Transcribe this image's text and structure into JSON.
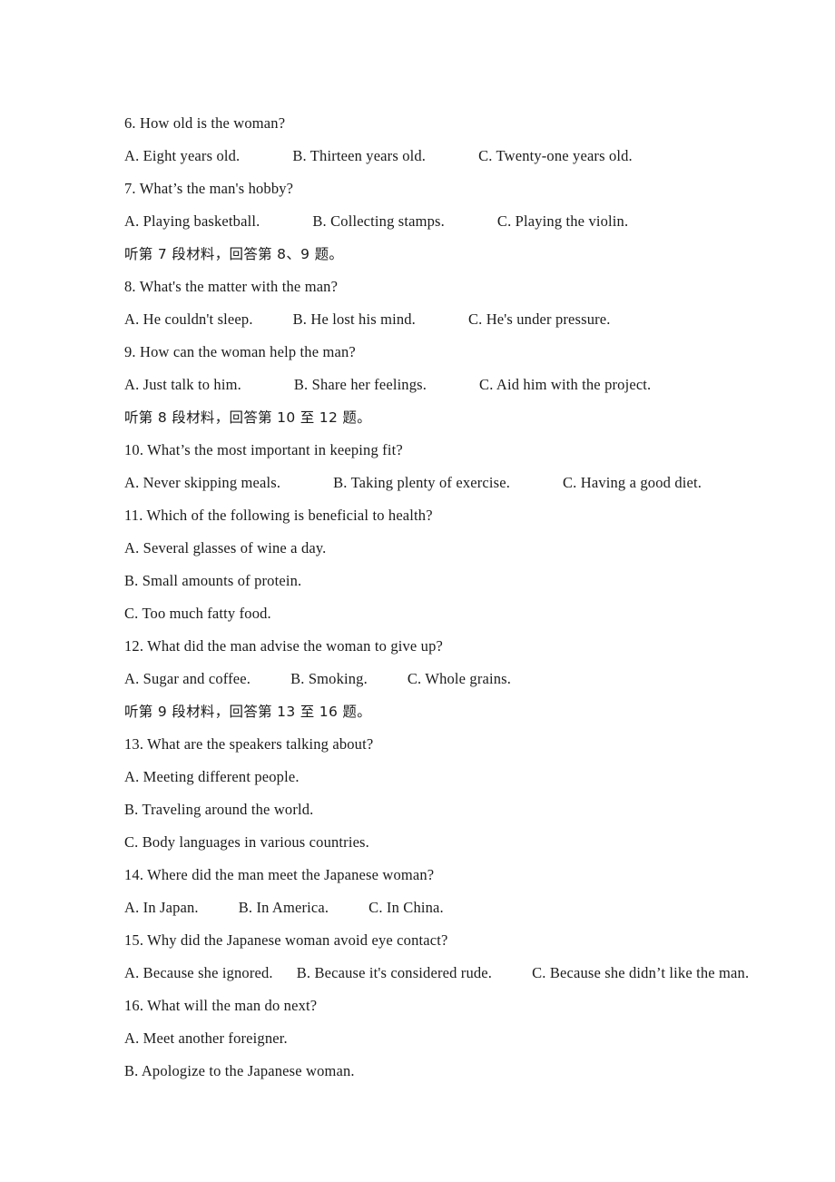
{
  "document": {
    "type": "listening-comprehension-exam-page",
    "language_primary": "English",
    "language_secondary": "Chinese",
    "background_color": "#ffffff",
    "text_color": "#1b1b1b"
  },
  "lines": [
    {
      "id": "q6-stem",
      "kind": "question",
      "text": "6. How old is the woman?"
    },
    {
      "id": "q6-options",
      "kind": "options",
      "options": [
        "A. Eight years old.",
        "B. Thirteen years old.",
        "C. Twenty-one years old."
      ],
      "gaps": [
        "lg",
        "lg"
      ]
    },
    {
      "id": "q7-stem",
      "kind": "question",
      "text": "7. What’s the man's hobby?"
    },
    {
      "id": "q7-options",
      "kind": "options",
      "options": [
        "A. Playing basketball.",
        "B. Collecting stamps.",
        "C. Playing the violin."
      ],
      "gaps": [
        "lg",
        "lg"
      ]
    },
    {
      "id": "cn-section-7",
      "kind": "chinese-instruction",
      "text": "听第 7 段材料，回答第 8、9 题。"
    },
    {
      "id": "q8-stem",
      "kind": "question",
      "text": "8. What's the matter with the man?"
    },
    {
      "id": "q8-options",
      "kind": "options",
      "options": [
        "A. He couldn't sleep.",
        "B. He lost his mind.",
        "C. He's under pressure."
      ],
      "gaps": [
        "md",
        "lg"
      ]
    },
    {
      "id": "q9-stem",
      "kind": "question",
      "text": "9. How can the woman help the man?"
    },
    {
      "id": "q9-options",
      "kind": "options",
      "options": [
        "A. Just talk to him.",
        "B. Share her feelings.",
        "C. Aid him with the project."
      ],
      "gaps": [
        "lg",
        "lg"
      ]
    },
    {
      "id": "cn-section-8",
      "kind": "chinese-instruction",
      "text": "听第 8 段材料，回答第 10 至 12 题。"
    },
    {
      "id": "q10-stem",
      "kind": "question",
      "text": "10. What’s the most important in keeping fit?"
    },
    {
      "id": "q10-options",
      "kind": "options",
      "options": [
        "A. Never skipping meals.",
        "B. Taking plenty of exercise.",
        "C. Having a good diet."
      ],
      "gaps": [
        "lg",
        "lg"
      ]
    },
    {
      "id": "q11-stem",
      "kind": "question",
      "text": "11. Which of the following is beneficial to health?"
    },
    {
      "id": "q11-option-a",
      "kind": "option-single",
      "text": "A. Several glasses of wine a day."
    },
    {
      "id": "q11-option-b",
      "kind": "option-single",
      "text": "B. Small amounts of protein."
    },
    {
      "id": "q11-option-c",
      "kind": "option-single",
      "text": "C. Too much fatty food."
    },
    {
      "id": "q12-stem",
      "kind": "question",
      "text": "12. What did the man advise the woman to give up?"
    },
    {
      "id": "q12-options",
      "kind": "options",
      "options": [
        "A. Sugar and coffee.",
        "B. Smoking.",
        "C. Whole grains."
      ],
      "gaps": [
        "md",
        "md"
      ]
    },
    {
      "id": "cn-section-9",
      "kind": "chinese-instruction",
      "text": "听第 9 段材料，回答第 13 至 16 题。"
    },
    {
      "id": "q13-stem",
      "kind": "question",
      "text": "13. What are the speakers talking about?"
    },
    {
      "id": "q13-option-a",
      "kind": "option-single",
      "text": "A. Meeting different people."
    },
    {
      "id": "q13-option-b",
      "kind": "option-single",
      "text": "B. Traveling around the world."
    },
    {
      "id": "q13-option-c",
      "kind": "option-single",
      "text": "C. Body languages in various countries."
    },
    {
      "id": "q14-stem",
      "kind": "question",
      "text": "14. Where did the man meet the Japanese woman?"
    },
    {
      "id": "q14-options",
      "kind": "options",
      "options": [
        "A. In Japan.",
        "B. In America.",
        "C. In China."
      ],
      "gaps": [
        "md",
        "md"
      ]
    },
    {
      "id": "q15-stem",
      "kind": "question",
      "text": "15. Why did the Japanese woman avoid eye contact?"
    },
    {
      "id": "q15-options",
      "kind": "options",
      "options": [
        "A. Because she ignored.",
        "B. Because it's considered rude.",
        "C. Because she didn’t like the man."
      ],
      "gaps": [
        "sm",
        "md"
      ]
    },
    {
      "id": "q16-stem",
      "kind": "question",
      "text": "16. What will the man do next?"
    },
    {
      "id": "q16-option-a",
      "kind": "option-single",
      "text": "A. Meet another foreigner."
    },
    {
      "id": "q16-option-b",
      "kind": "option-single",
      "text": "B. Apologize to the Japanese woman."
    }
  ]
}
